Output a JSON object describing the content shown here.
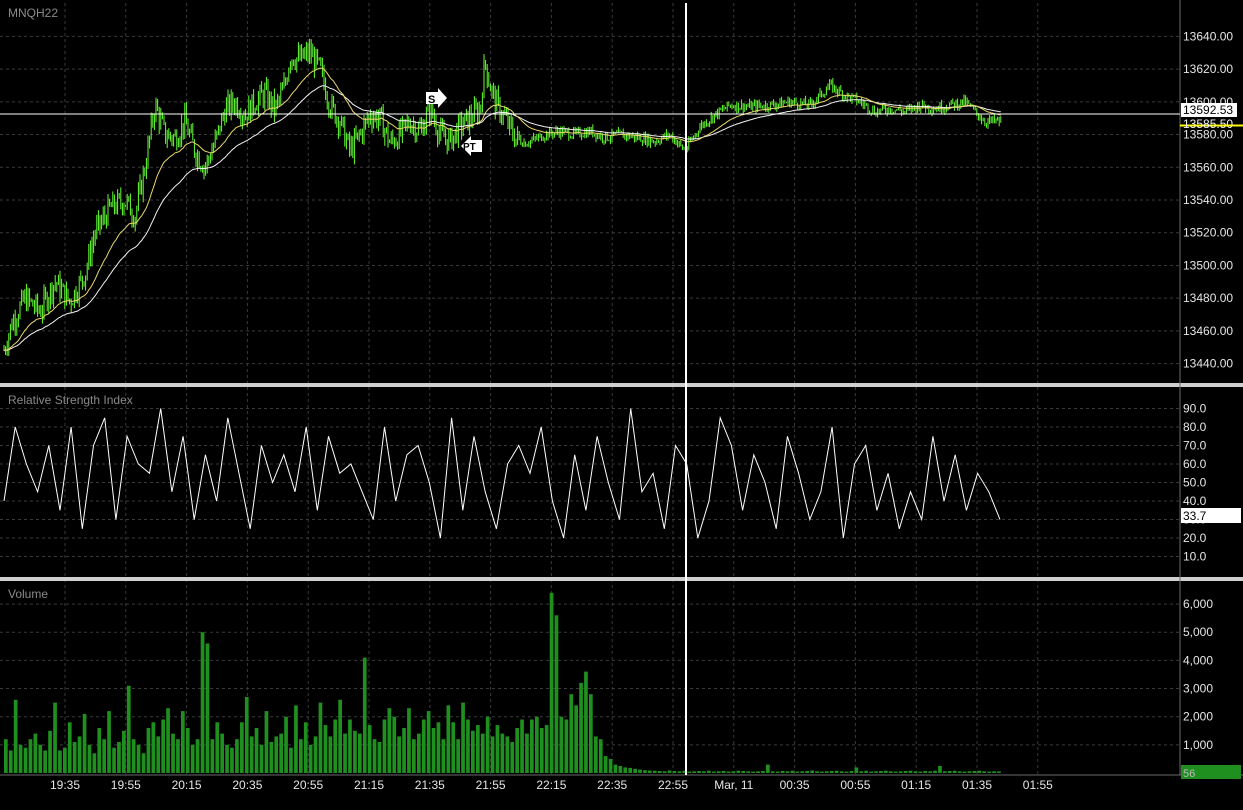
{
  "symbol": "MNQH22",
  "panels": {
    "price": {
      "title": "MNQH22",
      "y_ticks": [
        "13640.00",
        "13620.00",
        "13600.00",
        "13580.00",
        "13560.00",
        "13540.00",
        "13520.00",
        "13500.00",
        "13480.00",
        "13460.00",
        "13440.00"
      ],
      "last_price_label": "13592.53",
      "yellow_label": "13585.50",
      "markers": [
        "S",
        "PT"
      ]
    },
    "rsi": {
      "title": "Relative Strength Index",
      "y_ticks": [
        "90.0",
        "80.0",
        "70.0",
        "60.0",
        "50.0",
        "40.0",
        "30.0",
        "20.0",
        "10.0"
      ],
      "current_label": "33.7"
    },
    "volume": {
      "title": "Volume",
      "y_ticks": [
        "6,000",
        "5,000",
        "4,000",
        "3,000",
        "2,000",
        "1,000"
      ],
      "current_label": "56"
    }
  },
  "x_ticks": [
    "19:35",
    "19:55",
    "20:15",
    "20:35",
    "20:55",
    "21:15",
    "21:35",
    "21:55",
    "22:15",
    "22:35",
    "22:55",
    "Mar, 11",
    "00:35",
    "00:55",
    "01:15",
    "01:35",
    "01:55"
  ],
  "colors": {
    "background": "#000000",
    "candles": "#66ff33",
    "ma_fast": "#e8d86a",
    "ma_slow": "#f2f2f2",
    "rsi_line": "#ffffff",
    "volume_bars": "#1f8f1f",
    "grid": "#3a3a3a",
    "price_line": "#ffffff",
    "yellow_line": "#ffff00"
  },
  "chart_data": [
    {
      "type": "line",
      "title": "MNQH22",
      "x": [
        "19:35",
        "19:55",
        "20:15",
        "20:35",
        "20:55",
        "21:15",
        "21:35",
        "21:55",
        "22:15",
        "22:35",
        "22:55",
        "Mar, 11",
        "00:35",
        "00:55",
        "01:15",
        "01:35"
      ],
      "series": [
        {
          "values": [
            13445,
            13470,
            13560,
            13575,
            13595,
            13625,
            13578,
            13585,
            13615,
            13580,
            13582,
            13577,
            13570,
            13598,
            13598,
            13606,
            13592
          ]
        }
      ],
      "price_close_path": [
        [
          0,
          13440
        ],
        [
          12,
          13465
        ],
        [
          25,
          13480
        ],
        [
          40,
          13472
        ],
        [
          55,
          13490
        ],
        [
          70,
          13478
        ],
        [
          85,
          13495
        ],
        [
          95,
          13520
        ],
        [
          110,
          13535
        ],
        [
          125,
          13540
        ],
        [
          135,
          13530
        ],
        [
          145,
          13560
        ],
        [
          155,
          13598
        ],
        [
          165,
          13580
        ],
        [
          175,
          13578
        ],
        [
          185,
          13588
        ],
        [
          195,
          13570
        ],
        [
          205,
          13560
        ],
        [
          215,
          13575
        ],
        [
          225,
          13595
        ],
        [
          235,
          13600
        ],
        [
          245,
          13592
        ],
        [
          255,
          13600
        ],
        [
          265,
          13605
        ],
        [
          275,
          13595
        ],
        [
          285,
          13610
        ],
        [
          290,
          13628
        ],
        [
          300,
          13626
        ],
        [
          310,
          13630
        ],
        [
          320,
          13620
        ],
        [
          330,
          13598
        ],
        [
          340,
          13588
        ],
        [
          350,
          13570
        ],
        [
          360,
          13580
        ],
        [
          370,
          13592
        ],
        [
          380,
          13590
        ],
        [
          390,
          13575
        ],
        [
          400,
          13580
        ],
        [
          410,
          13588
        ],
        [
          420,
          13582
        ],
        [
          430,
          13596
        ],
        [
          440,
          13580
        ],
        [
          450,
          13576
        ],
        [
          460,
          13585
        ],
        [
          470,
          13590
        ],
        [
          480,
          13595
        ],
        [
          485,
          13625
        ],
        [
          490,
          13610
        ],
        [
          495,
          13600
        ],
        [
          505,
          13590
        ],
        [
          515,
          13578
        ],
        [
          525,
          13575
        ],
        [
          535,
          13577
        ],
        [
          545,
          13580
        ],
        [
          560,
          13582
        ],
        [
          575,
          13580
        ],
        [
          590,
          13582
        ],
        [
          605,
          13578
        ],
        [
          620,
          13580
        ],
        [
          640,
          13578
        ],
        [
          655,
          13576
        ],
        [
          670,
          13580
        ],
        [
          685,
          13570
        ],
        [
          700,
          13585
        ],
        [
          715,
          13592
        ],
        [
          730,
          13598
        ],
        [
          750,
          13597
        ],
        [
          770,
          13598
        ],
        [
          790,
          13600
        ],
        [
          810,
          13598
        ],
        [
          830,
          13610
        ],
        [
          845,
          13604
        ],
        [
          860,
          13600
        ],
        [
          875,
          13594
        ],
        [
          890,
          13596
        ],
        [
          905,
          13594
        ],
        [
          920,
          13598
        ],
        [
          935,
          13596
        ],
        [
          950,
          13598
        ],
        [
          965,
          13600
        ],
        [
          975,
          13594
        ],
        [
          985,
          13588
        ],
        [
          1000,
          13588
        ]
      ],
      "ylim": [
        13430,
        13650
      ],
      "last_price": 13592.53,
      "reference_price": 13585.5
    },
    {
      "type": "line",
      "title": "Relative Strength Index",
      "values": [
        40,
        80,
        60,
        45,
        70,
        35,
        80,
        25,
        70,
        85,
        30,
        75,
        60,
        55,
        90,
        45,
        75,
        30,
        65,
        40,
        85,
        55,
        25,
        70,
        50,
        65,
        45,
        80,
        35,
        75,
        55,
        60,
        45,
        30,
        80,
        40,
        65,
        70,
        50,
        20,
        85,
        35,
        75,
        45,
        25,
        60,
        70,
        55,
        80,
        40,
        20,
        65,
        35,
        75,
        50,
        30,
        90,
        45,
        55,
        25,
        70,
        60,
        20,
        40,
        85,
        70,
        35,
        65,
        50,
        25,
        75,
        55,
        30,
        45,
        80,
        20,
        60,
        70,
        35,
        55,
        25,
        45,
        30,
        75,
        40,
        65,
        35,
        55,
        45,
        30
      ],
      "ylim": [
        0,
        100
      ],
      "current": 33.7
    },
    {
      "type": "bar",
      "title": "Volume",
      "values": [
        1200,
        800,
        2600,
        1000,
        900,
        1200,
        1400,
        1000,
        800,
        1500,
        2500,
        800,
        900,
        1800,
        1100,
        1300,
        2100,
        1000,
        700,
        1600,
        1200,
        2200,
        900,
        1100,
        1500,
        3100,
        1200,
        1000,
        700,
        1600,
        1800,
        1300,
        1900,
        2300,
        1400,
        1200,
        2200,
        1600,
        1000,
        1200,
        5000,
        4600,
        1200,
        1800,
        1400,
        1000,
        900,
        1200,
        1800,
        2700,
        1300,
        1600,
        1000,
        2200,
        1100,
        1300,
        1400,
        2000,
        900,
        2400,
        1200,
        1800,
        1000,
        1300,
        2500,
        1700,
        1300,
        1900,
        2600,
        1400,
        1900,
        1500,
        1400,
        4100,
        1700,
        1200,
        1100,
        1900,
        2300,
        2000,
        1300,
        1600,
        2300,
        1200,
        1400,
        1900,
        2200,
        1600,
        1800,
        1200,
        2400,
        1800,
        1200,
        2500,
        1900,
        1500,
        1700,
        1400,
        2000,
        1300,
        1700,
        1400,
        1300,
        1100,
        1600,
        1900,
        1400,
        1900,
        2000,
        1600,
        1700,
        6400,
        5600,
        2000,
        1900,
        2800,
        2400,
        3200,
        3600,
        2800,
        1300,
        1200,
        600,
        500,
        300,
        250,
        200,
        180,
        150,
        120,
        100,
        90,
        80,
        70,
        60,
        90,
        70,
        60,
        80,
        50,
        60,
        70,
        60,
        80,
        50,
        60,
        70,
        50,
        60,
        80,
        70,
        60,
        50,
        60,
        70,
        300,
        60,
        50,
        70,
        60,
        80,
        50,
        60,
        70,
        90,
        60,
        50,
        60,
        70,
        80,
        60,
        50,
        70,
        200,
        60,
        80,
        50,
        60,
        70,
        80,
        60,
        50,
        60,
        70,
        80,
        60,
        50,
        70,
        60,
        80,
        250,
        60,
        70,
        80,
        60,
        50,
        60,
        70,
        80,
        60,
        50,
        60,
        56
      ],
      "ylim": [
        0,
        6500
      ],
      "current": 56
    }
  ]
}
